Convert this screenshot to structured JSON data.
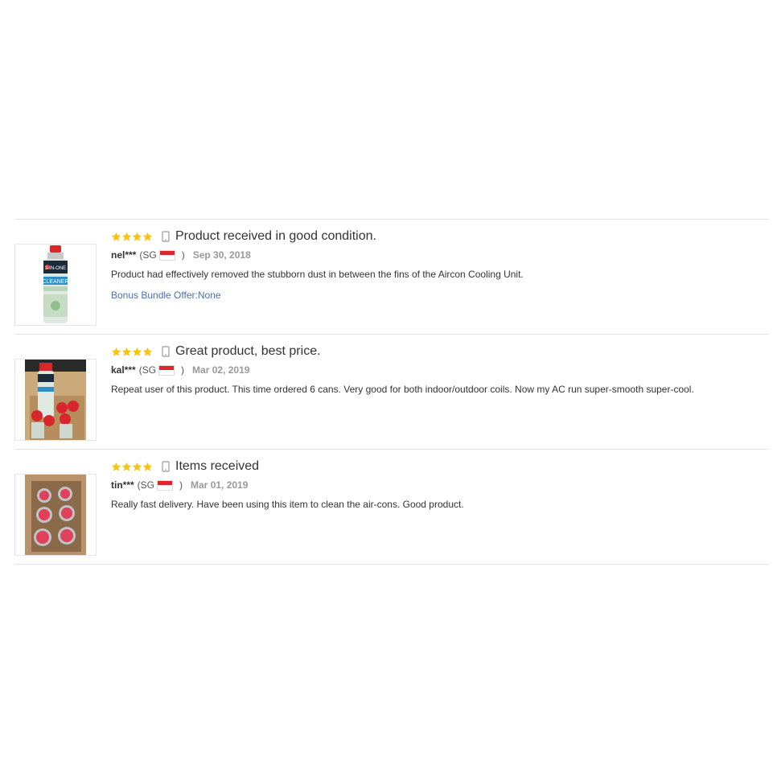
{
  "colors": {
    "star": "#f6c30f",
    "link": "#4a6fb5",
    "date": "#999999",
    "divider": "#e3e3e3"
  },
  "reviews": [
    {
      "title": "Product received in good condition.",
      "user": "nel***",
      "country": "(SG",
      "country_close": ")",
      "date": "Sep 30, 2018",
      "content": "Product had effectively removed the stubborn dust in between the fins of the Aircon Cooling Unit.",
      "bonus": "Bonus Bundle Offer:None",
      "stars": 4,
      "device_icon": "mobile-icon"
    },
    {
      "title": "Great product, best price.",
      "user": "kal***",
      "country": "(SG",
      "country_close": ")",
      "date": "Mar 02, 2019",
      "content": "Repeat user of this product. This time ordered 6 cans. Very good for both indoor/outdoor coils. Now my AC run super-smooth super-cool.",
      "stars": 4,
      "device_icon": "mobile-icon"
    },
    {
      "title": "Items received",
      "user": "tin***",
      "country": "(SG",
      "country_close": ")",
      "date": "Mar 01, 2019",
      "content": "Really fast delivery. Have been using this item to clean the air-cons. Good product.",
      "stars": 4,
      "device_icon": "mobile-icon"
    }
  ]
}
